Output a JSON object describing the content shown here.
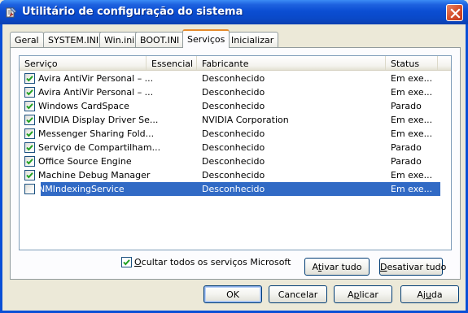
{
  "window": {
    "title": "Utilitário de configuração do sistema",
    "title_icon": "msconfig-icon",
    "close_icon": "close-icon"
  },
  "tabs": [
    {
      "label": "Geral",
      "active": false
    },
    {
      "label": "SYSTEM.INI",
      "active": false
    },
    {
      "label": "Win.ini",
      "active": false
    },
    {
      "label": "BOOT.INI",
      "active": false
    },
    {
      "label": "Serviços",
      "active": true
    },
    {
      "label": "Inicializar",
      "active": false
    }
  ],
  "services": {
    "columns": [
      "Serviço",
      "Essencial",
      "Fabricante",
      "Status"
    ],
    "rows": [
      {
        "name": "Avira AntiVir Personal – ...",
        "essential": "",
        "manufacturer": "Desconhecido",
        "status": "Em exe...",
        "checked": true,
        "selected": false
      },
      {
        "name": "Avira AntiVir Personal – ...",
        "essential": "",
        "manufacturer": "Desconhecido",
        "status": "Em exe...",
        "checked": true,
        "selected": false
      },
      {
        "name": "Windows CardSpace",
        "essential": "",
        "manufacturer": "Desconhecido",
        "status": "Parado",
        "checked": true,
        "selected": false
      },
      {
        "name": "NVIDIA Display Driver Se...",
        "essential": "",
        "manufacturer": "NVIDIA Corporation",
        "status": "Em exe...",
        "checked": true,
        "selected": false
      },
      {
        "name": "Messenger Sharing Fold...",
        "essential": "",
        "manufacturer": "Desconhecido",
        "status": "Em exe...",
        "checked": true,
        "selected": false
      },
      {
        "name": "Serviço de Compartilham...",
        "essential": "",
        "manufacturer": "Desconhecido",
        "status": "Parado",
        "checked": true,
        "selected": false
      },
      {
        "name": "Office Source Engine",
        "essential": "",
        "manufacturer": "Desconhecido",
        "status": "Parado",
        "checked": true,
        "selected": false
      },
      {
        "name": "Machine Debug Manager",
        "essential": "",
        "manufacturer": "Desconhecido",
        "status": "Em exe...",
        "checked": true,
        "selected": false
      },
      {
        "name": "NMIndexingService",
        "essential": "",
        "manufacturer": "Desconhecido",
        "status": "Em exe...",
        "checked": false,
        "selected": true
      }
    ]
  },
  "hide_ms": {
    "label_pre": "O",
    "label_rest": "cultar todos os serviços Microsoft",
    "checked": true
  },
  "buttons": {
    "enable_all": {
      "pre": "A",
      "ul": "t",
      "post": "ivar tudo"
    },
    "disable_all": {
      "pre": "",
      "ul": "D",
      "post": "esativar tudo"
    },
    "ok": "OK",
    "cancel": "Cancelar",
    "apply": {
      "pre": "A",
      "ul": "p",
      "post": "licar"
    },
    "help": {
      "pre": "Aj",
      "ul": "u",
      "post": "da"
    }
  },
  "colors": {
    "title_bar": "#0a4fd6",
    "selection": "#316ac5",
    "active_tab_accent": "#e68b2c"
  }
}
